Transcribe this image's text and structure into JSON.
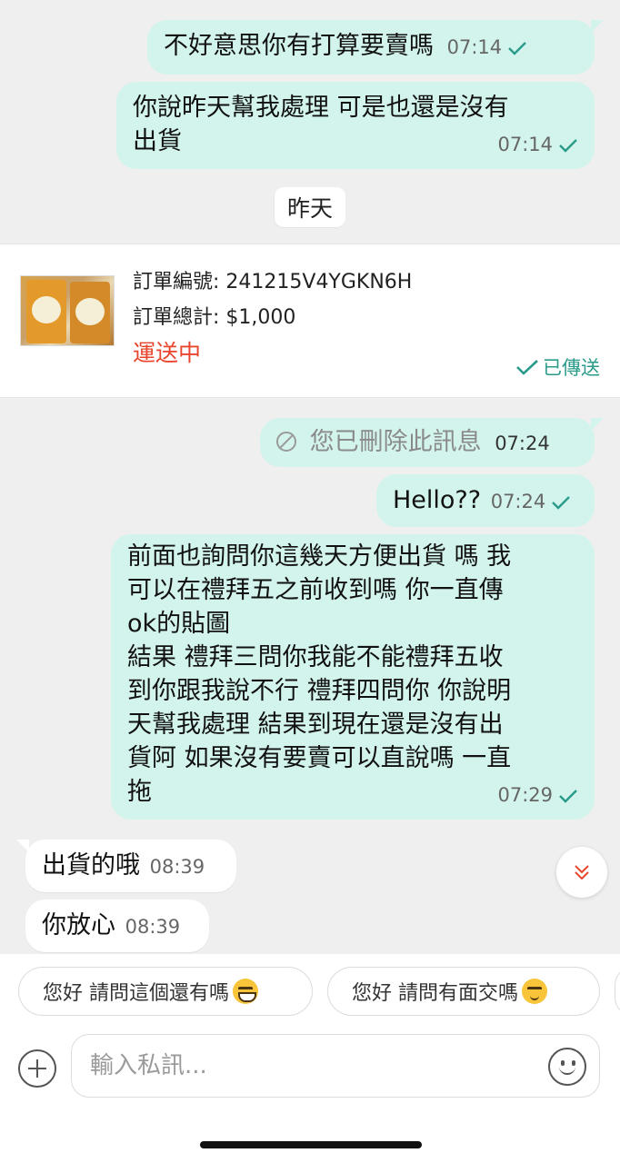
{
  "messages": [
    {
      "text": "不好意思你有打算要賣嗎",
      "time": "07:14"
    },
    {
      "text_line1": "你說昨天幫我處理 可是也還是沒有",
      "text_line2": "出貨",
      "time": "07:14"
    }
  ],
  "date_divider": "昨天",
  "order_card": {
    "number_label": "訂單編號: 241215V4YGKN6H",
    "total_label": "訂單總計: $1,000",
    "status": "運送中",
    "sent_label": "已傳送"
  },
  "deleted_message": {
    "text": "您已刪除此訊息",
    "time": "07:24"
  },
  "hello_message": {
    "text": "Hello??",
    "time": "07:24"
  },
  "long_message": {
    "lines": [
      "前面也詢問你這幾天方便出貨 嗎 我",
      "可以在禮拜五之前收到嗎 你一直傳",
      "ok的貼圖",
      "結果 禮拜三問你我能不能禮拜五收",
      "到你跟我說不行 禮拜四問你 你說明",
      "天幫我處理 結果到現在還是沒有出",
      "貨阿 如果沒有要賣可以直說嗎 一直",
      "拖"
    ],
    "time": "07:29"
  },
  "incoming": [
    {
      "text": "出貨的哦",
      "time": "08:39"
    },
    {
      "text": "你放心",
      "time": "08:39"
    }
  ],
  "quick_replies": [
    {
      "text": "您好 請問這個還有嗎",
      "emoji": "grinning-face-icon"
    },
    {
      "text": "您好 請問有面交嗎",
      "emoji": "relieved-face-icon"
    }
  ],
  "input": {
    "placeholder": "輸入私訊..."
  },
  "colors": {
    "outgoing": "#d3f4ec",
    "incoming": "#ffffff",
    "status_red": "#e8452c",
    "check_teal": "#2a9b8a"
  }
}
